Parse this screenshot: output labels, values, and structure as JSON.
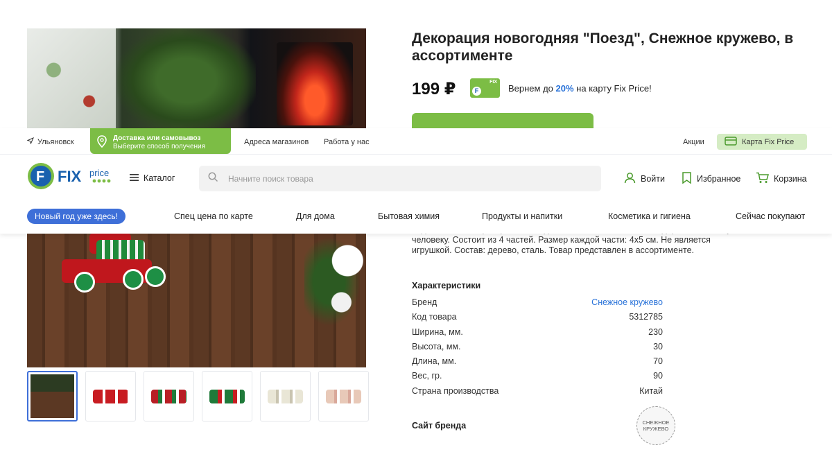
{
  "product": {
    "title": "Декорация новогодняя \"Поезд\", Снежное кружево, в ассортименте",
    "price": "199 ₽",
    "card_logo_text": "FIX",
    "card_logo_letter": "F",
    "cashback_prefix": "Вернем до ",
    "cashback_percent": "20%",
    "cashback_suffix": " на карту Fix Price!",
    "description": "подоконник или пространство под ёлкой. Станет отличным подарком близкому человеку. Состоит из 4 частей. Размер каждой части: 4х5 см. Не является игрушкой. Состав: дерево, сталь. Товар представлен в ассортименте.",
    "characteristics_title": "Характеристики",
    "characteristics": [
      {
        "label": "Бренд",
        "value": "Снежное кружево"
      },
      {
        "label": "Код товара",
        "value": "5312785"
      },
      {
        "label": "Ширина, мм.",
        "value": "230"
      },
      {
        "label": "Высота, мм.",
        "value": "30"
      },
      {
        "label": "Длина, мм.",
        "value": "70"
      },
      {
        "label": "Вес, гр.",
        "value": "90"
      },
      {
        "label": "Страна производства",
        "value": "Китай"
      }
    ],
    "brand_site_title": "Сайт бренда",
    "brand_logo_text": "СНЕЖНОЕ КРУЖЕВО"
  },
  "header": {
    "city": "Ульяновск",
    "delivery_title": "Доставка или самовывоз",
    "delivery_subtitle": "Выберите способ получения",
    "links": [
      "Адреса магазинов",
      "Работа у нас"
    ],
    "promotions": "Акции",
    "card_button": "Карта Fix Price",
    "logo_text_fix": "FIX",
    "logo_text_price": "price",
    "catalog": "Каталог",
    "search_placeholder": "Начните поиск товара",
    "login": "Войти",
    "favorites": "Избранное",
    "cart": "Корзина"
  },
  "nav": {
    "highlight": "Новый год уже здесь!",
    "items": [
      "Спец цена по карте",
      "Для дома",
      "Бытовая химия",
      "Продукты и напитки",
      "Косметика и гигиена",
      "Сейчас покупают"
    ]
  },
  "colors": {
    "brand_green": "#7cbd45",
    "brand_blue": "#3e6fd8",
    "link_blue": "#2a73d9",
    "card_button_bg": "#d5ecc4"
  },
  "icons": [
    "location-arrow-icon",
    "map-pin-icon",
    "card-icon",
    "menu-icon",
    "search-icon",
    "user-icon",
    "bookmark-icon",
    "cart-icon"
  ]
}
